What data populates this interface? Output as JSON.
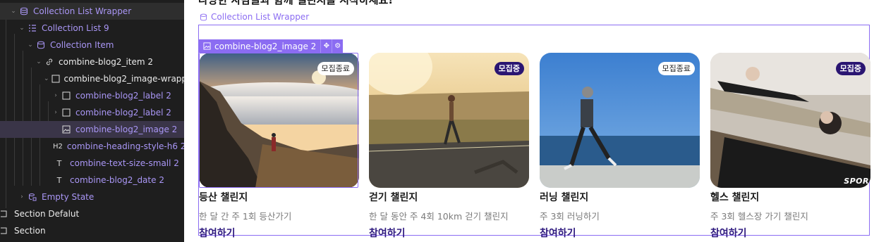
{
  "navigator": {
    "items": [
      {
        "label": "Collection List Wrapper",
        "icon": "collection-wrapper-icon"
      },
      {
        "label": "Collection List 9",
        "icon": "collection-list-icon"
      },
      {
        "label": "Collection Item",
        "icon": "collection-item-icon"
      },
      {
        "label": "combine-blog2_item 2",
        "icon": "link-icon"
      },
      {
        "label": "combine-blog2_image-wrappe...",
        "icon": "div-block-icon"
      },
      {
        "label": "combine-blog2_label 2",
        "icon": "div-block-icon"
      },
      {
        "label": "combine-blog2_label 2",
        "icon": "div-block-icon"
      },
      {
        "label": "combine-blog2_image 2",
        "icon": "image-icon"
      },
      {
        "label": "combine-heading-style-h6 2",
        "icon": "h2-icon",
        "icon_text": "H2"
      },
      {
        "label": "combine-text-size-small 2",
        "icon": "text-icon",
        "icon_text": "T"
      },
      {
        "label": "combine-blog2_date 2",
        "icon": "text-icon",
        "icon_text": "T"
      },
      {
        "label": "Empty State",
        "icon": "empty-state-icon"
      },
      {
        "label": "Section Defalut",
        "icon": "section-icon"
      },
      {
        "label": "Section",
        "icon": "section-icon"
      }
    ]
  },
  "canvas": {
    "heading": "다양한 사람들과 함께 챌린지를 시작하세요!",
    "wrapper_label": "Collection List Wrapper",
    "selected_label": "combine-blog2_image 2",
    "cards": [
      {
        "title": "등산 챌린지",
        "desc": "한 달 간 주 1회 등산가기",
        "cta": "참여하기",
        "badge": "모집종료",
        "badge_type": "closed"
      },
      {
        "title": "걷기 챌린지",
        "desc": "한 달 동안 주 4회 10km 걷기 챌린지",
        "cta": "참여하기",
        "badge": "모집중",
        "badge_type": "open"
      },
      {
        "title": "러닝 챌린지",
        "desc": "주 3회 러닝하기",
        "cta": "참여하기",
        "badge": "모집종료",
        "badge_type": "closed"
      },
      {
        "title": "헬스 챌린지",
        "desc": "주 3회 헬스장 가기 챌린지",
        "cta": "참여하기",
        "badge": "모집중",
        "badge_type": "open",
        "watermark": "SPOR"
      }
    ]
  },
  "colors": {
    "accent": "#8b6cf2",
    "badge_open": "#2a1572",
    "cta": "#2f1a7f",
    "panel_bg": "#1e1e1e"
  }
}
